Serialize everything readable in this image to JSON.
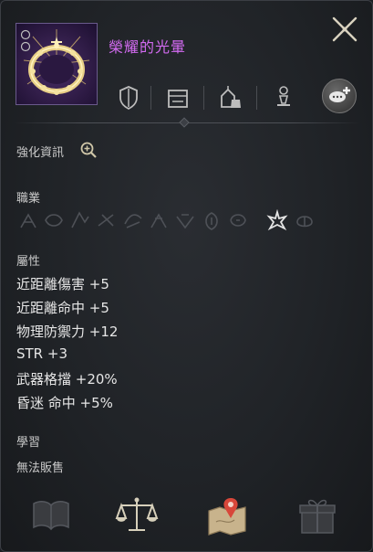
{
  "item": {
    "name": "榮耀的光暈",
    "name_color": "#d36bf1",
    "icon": "glory-halo-crown-icon"
  },
  "header_icons": [
    "shield-icon",
    "storage-chest-icon",
    "house-bag-icon",
    "pedestal-icon",
    "chat-add-icon"
  ],
  "enhance": {
    "label": "強化資訊",
    "icon": "magnifier-plus-icon"
  },
  "job": {
    "label": "職業",
    "class_icons": [
      "class-1-icon",
      "class-2-icon",
      "class-3-icon",
      "class-4-icon",
      "class-5-icon",
      "class-6-icon",
      "class-7-icon",
      "class-8-icon",
      "class-9-icon",
      "class-10-active-icon",
      "class-11-icon"
    ],
    "active_index": 9
  },
  "attributes": {
    "label": "屬性",
    "lines": [
      "近距離傷害 +5",
      "近距離命中 +5",
      "物理防禦力 +12",
      "STR +3",
      "武器格擋 +20%",
      "昏迷 命中 +5%"
    ]
  },
  "learn": {
    "label": "學習",
    "value": "無法販售"
  },
  "bottom_icons": [
    "book-icon",
    "scales-icon",
    "map-pin-icon",
    "gift-box-icon"
  ]
}
